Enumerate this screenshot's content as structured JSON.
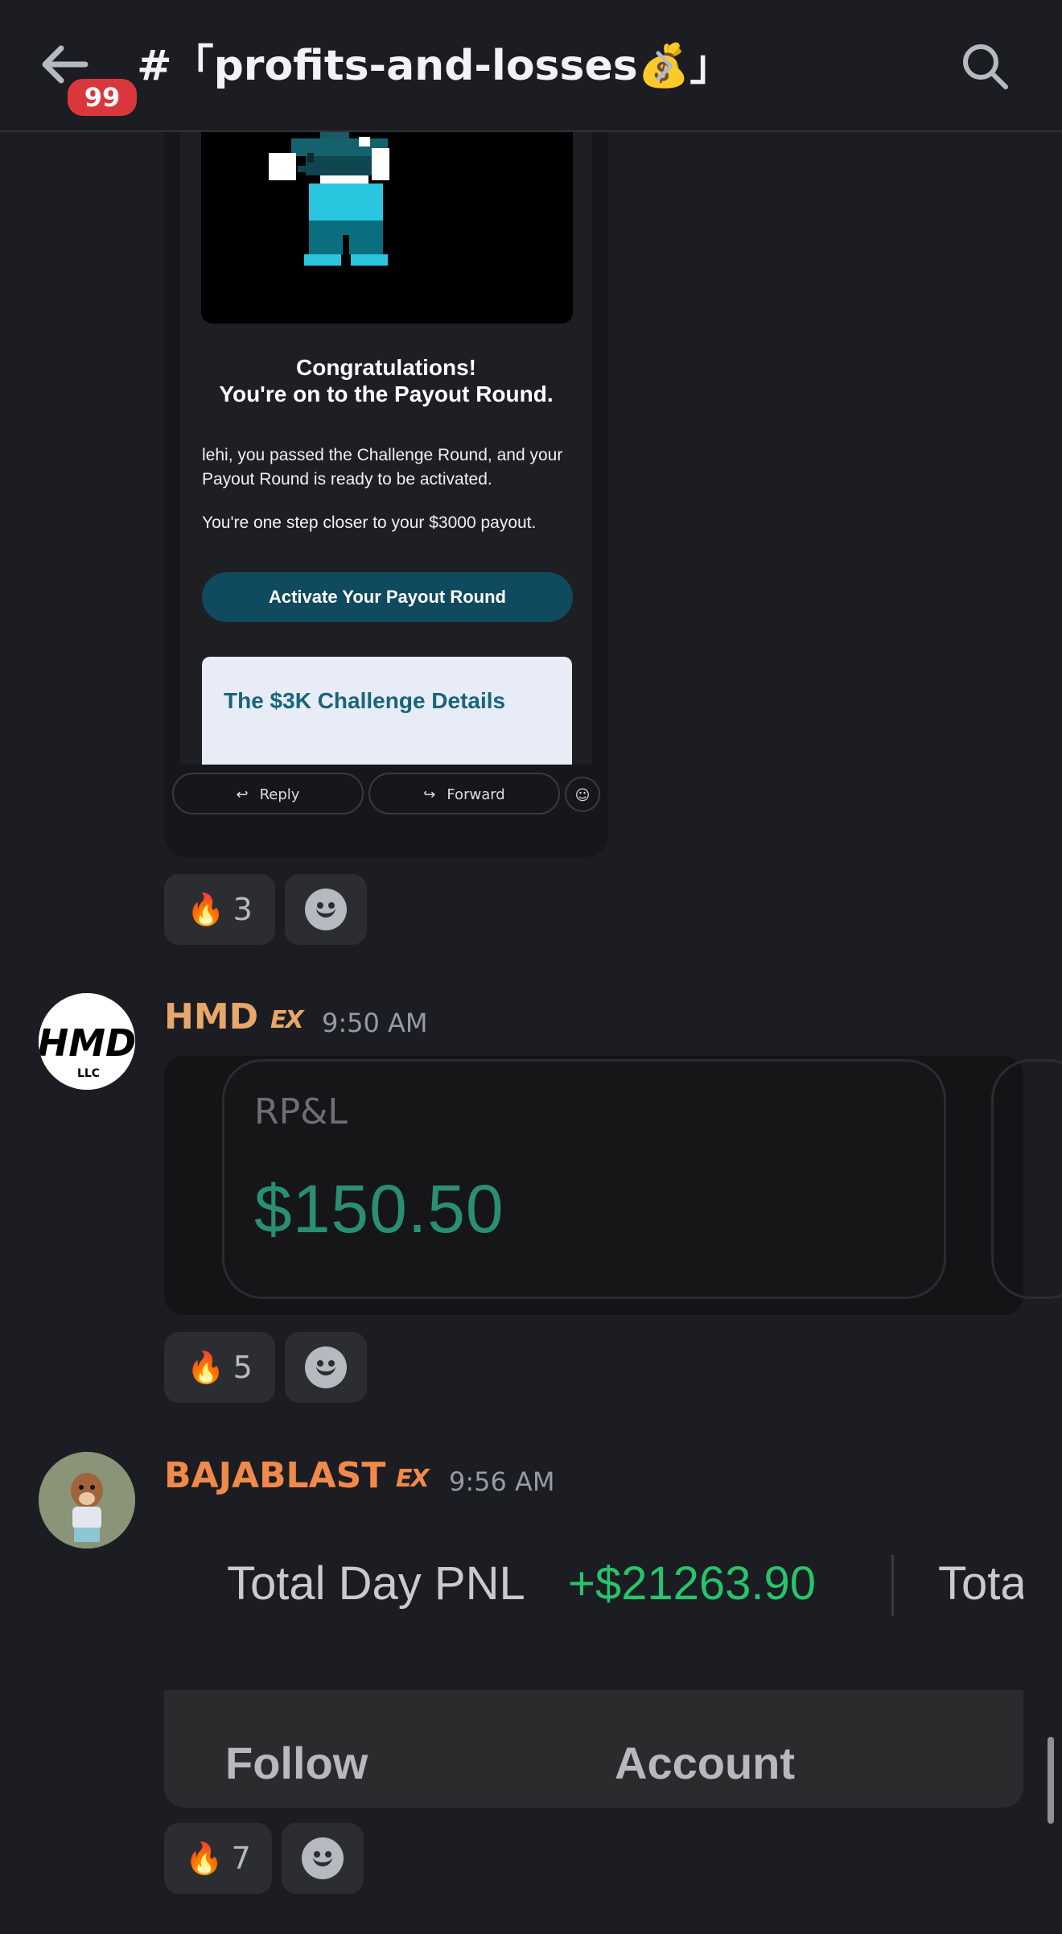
{
  "header": {
    "channel_name": "#「profits-and-losses💰」",
    "unread_badge": "99",
    "icons": {
      "back": "arrow-left-icon",
      "chevron": "chevron-right-icon",
      "search": "search-icon"
    }
  },
  "email_embed": {
    "heading_line1": "Congratulations!",
    "heading_line2": "You're on to the Payout Round.",
    "paragraph1": "lehi, you passed the Challenge Round, and your Payout Round is ready to be activated.",
    "paragraph2": "You're one step closer to your $3000 payout.",
    "cta_button": "Activate Your Payout Round",
    "details_title": "The $3K Challenge Details",
    "reply_label": "Reply",
    "forward_label": "Forward",
    "colors": {
      "cta": "#0f4a5e",
      "details_title": "#18657a",
      "details_bg": "#e8ecf6"
    }
  },
  "messages": [
    {
      "reactions": [
        {
          "emoji": "🔥",
          "count": "3"
        }
      ]
    },
    {
      "author": "HMD",
      "author_color": "#e7a76a",
      "tag": "EX",
      "time": "9:50 AM",
      "avatar_text": "HMD",
      "avatar_sub": "LLC",
      "card": {
        "label": "RP&L",
        "value": "$150.50",
        "value_color": "#2a8f72"
      },
      "reactions": [
        {
          "emoji": "🔥",
          "count": "5"
        }
      ]
    },
    {
      "author": "BAJABLAST",
      "author_color": "#f08a4b",
      "tag": "EX",
      "time": "9:56 AM",
      "card": {
        "label": "Total Day PNL",
        "value": "+$21263.90",
        "next_label": "Tota",
        "value_color": "#27c46b",
        "tab1": "Follow",
        "tab2": "Account"
      },
      "reactions": [
        {
          "emoji": "🔥",
          "count": "7"
        }
      ]
    }
  ]
}
